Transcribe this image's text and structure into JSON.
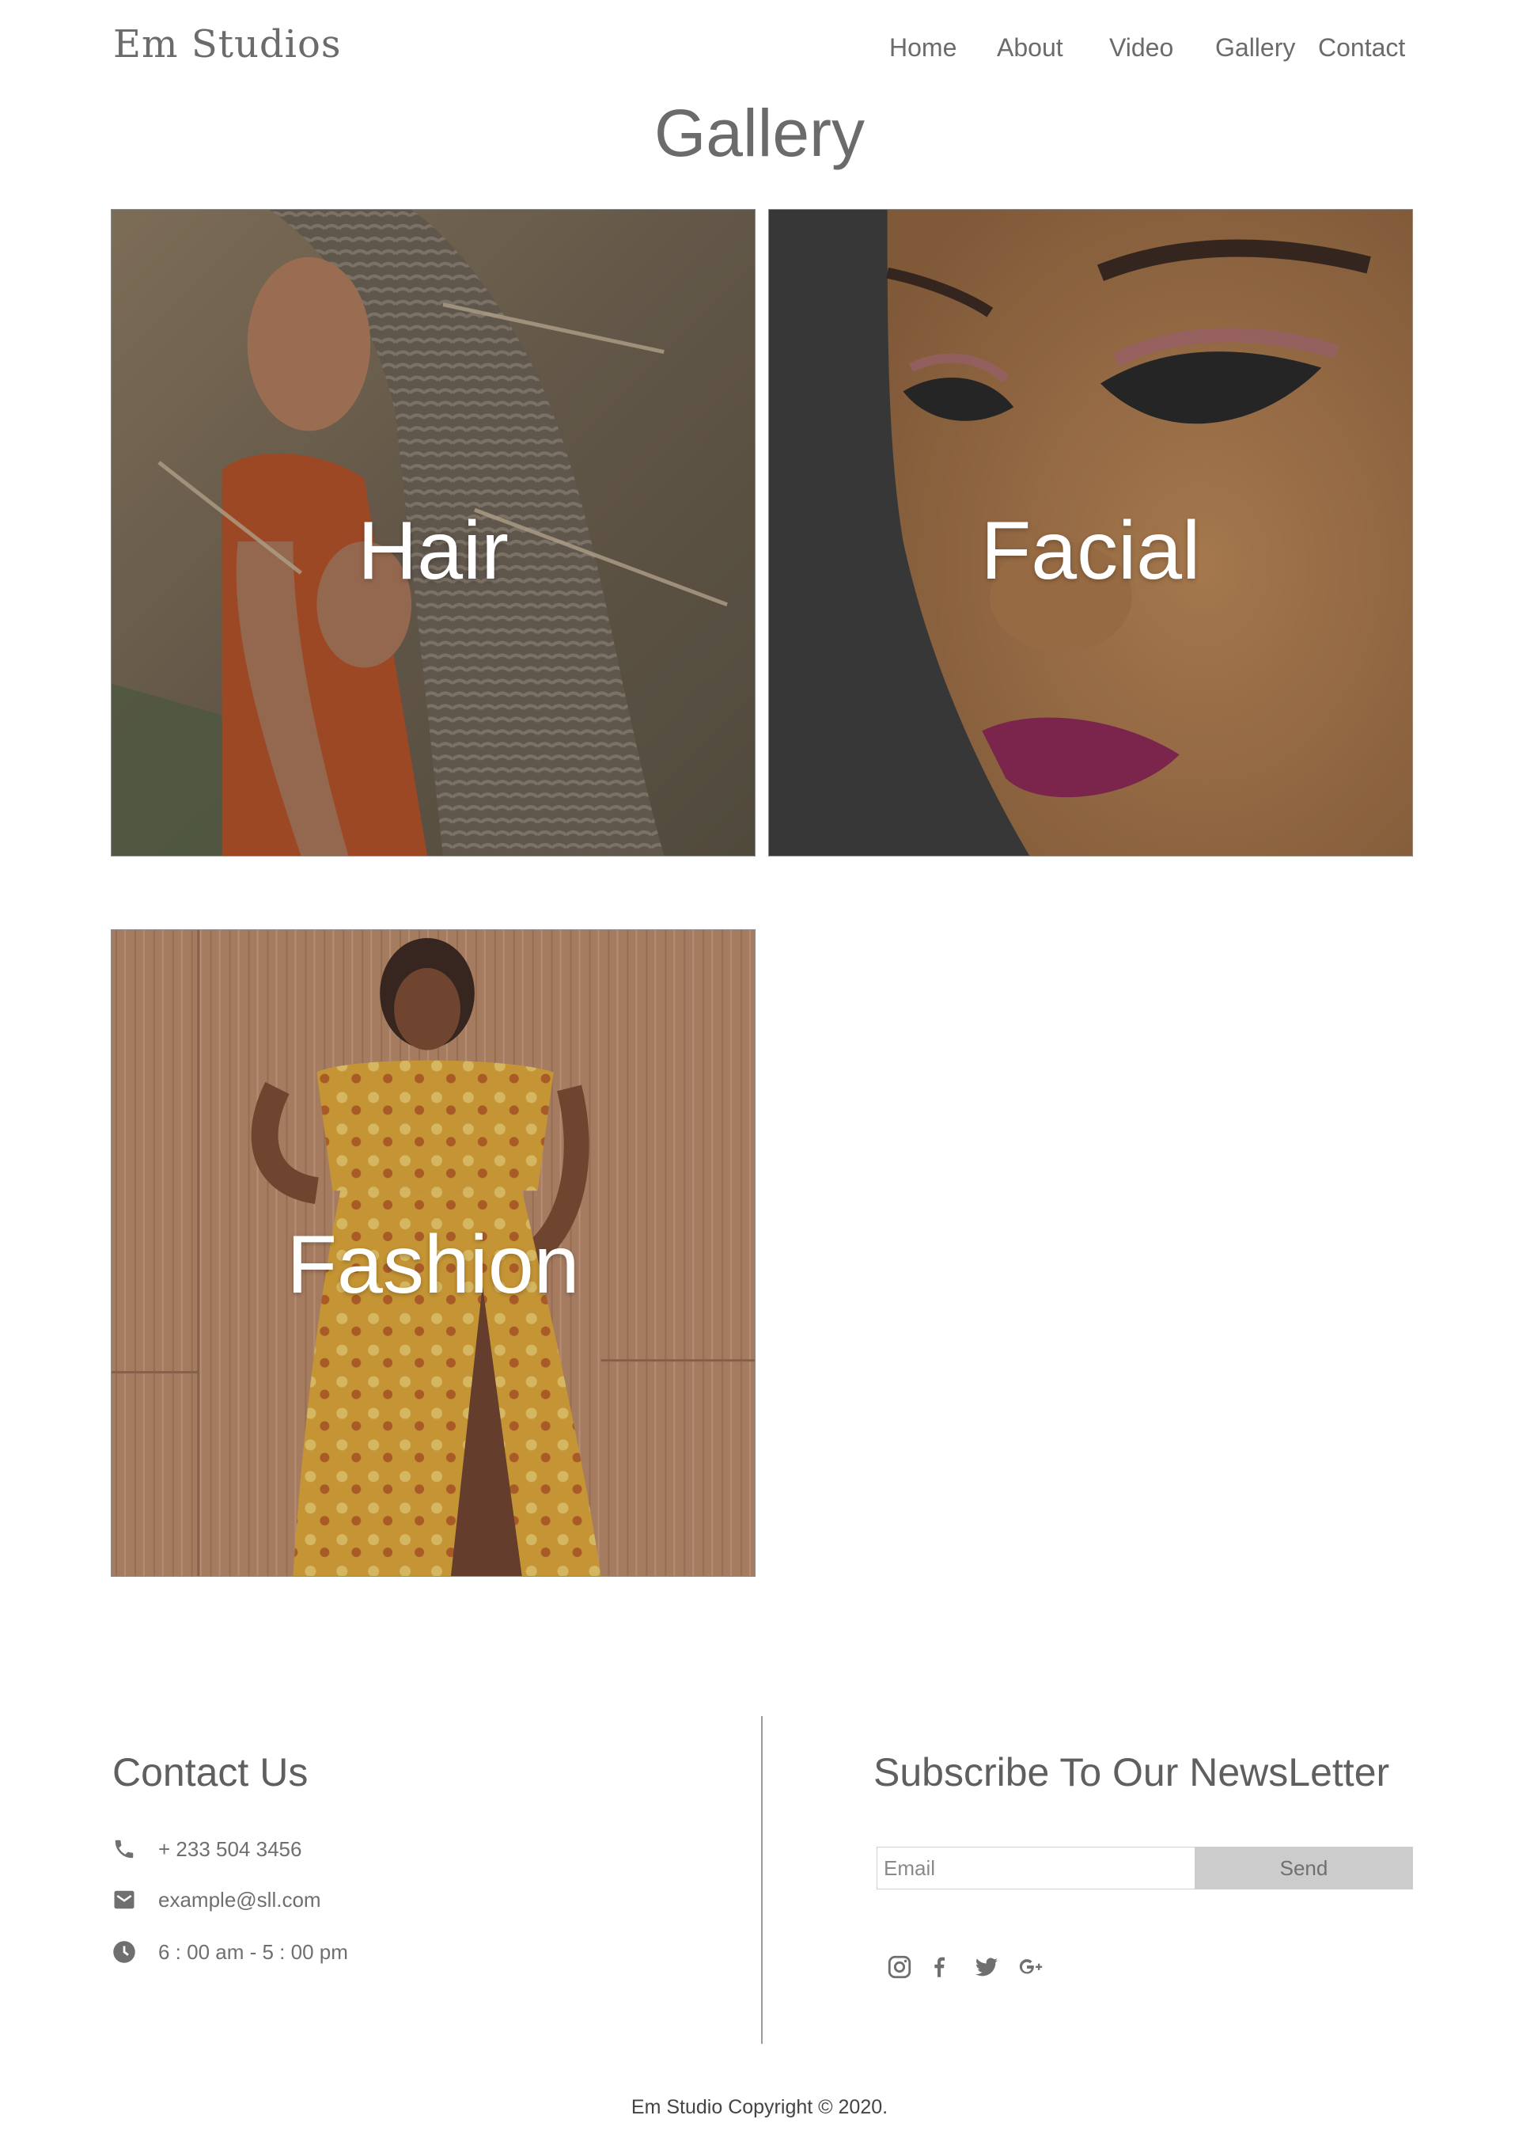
{
  "brand": {
    "logo_text": "Em Studios"
  },
  "nav": {
    "items": [
      {
        "label": "Home"
      },
      {
        "label": "About"
      },
      {
        "label": "Video"
      },
      {
        "label": "Gallery"
      },
      {
        "label": "Contact"
      }
    ]
  },
  "page": {
    "title": "Gallery"
  },
  "gallery": {
    "tiles": [
      {
        "label": "Hair"
      },
      {
        "label": "Facial"
      },
      {
        "label": "Fashion"
      }
    ]
  },
  "contact": {
    "title": "Contact Us",
    "phone": "+ 233 504 3456",
    "email": "example@sll.com",
    "hours": "6 : 00 am - 5 : 00 pm",
    "icons": [
      "phone-icon",
      "mail-icon",
      "clock-icon"
    ]
  },
  "newsletter": {
    "title": "Subscribe To Our NewsLetter",
    "email_placeholder": "Email",
    "send_label": "Send",
    "social_icons": [
      "instagram-icon",
      "facebook-icon",
      "twitter-icon",
      "google-plus-icon"
    ]
  },
  "footer": {
    "copyright": "Em Studio Copyright © 2020."
  },
  "colors": {
    "text": "#6b6b6b",
    "button_bg": "#cccccc",
    "divider": "#9a9a9a"
  }
}
